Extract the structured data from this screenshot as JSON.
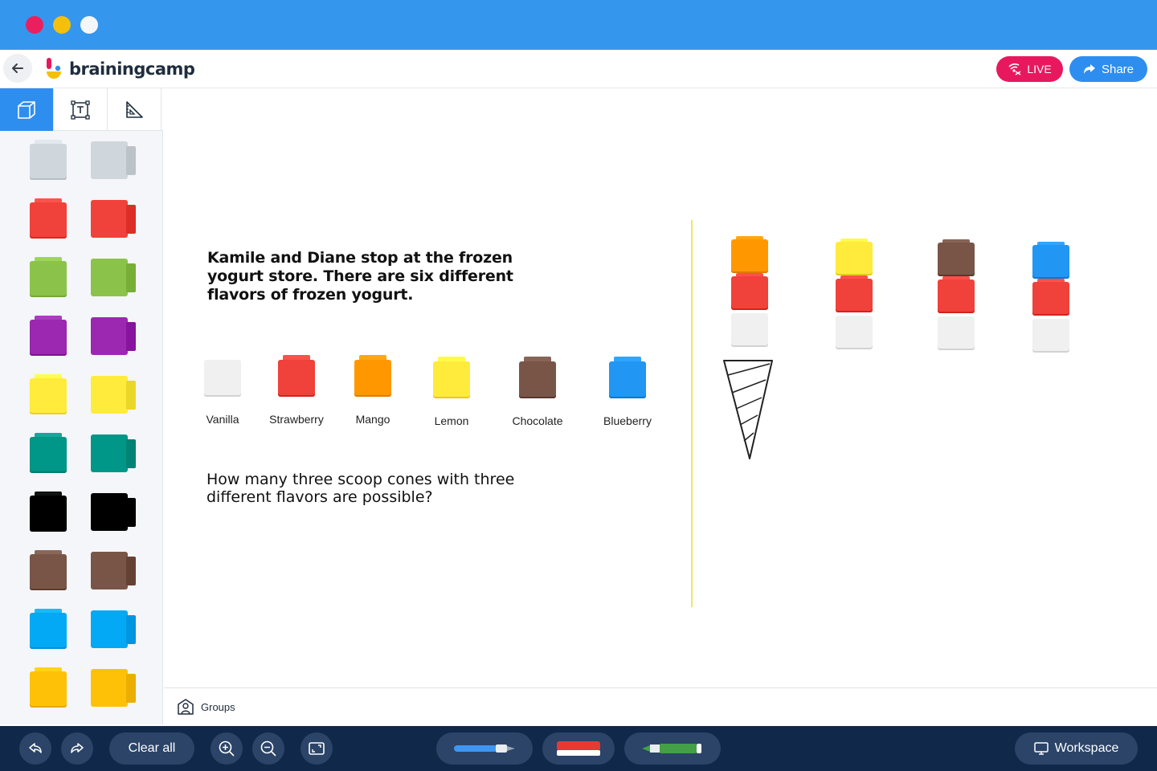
{
  "header": {
    "logo_text": "brainingcamp",
    "live_label": "LIVE",
    "share_label": "Share"
  },
  "sidebar": {
    "tabs": [
      {
        "name": "cubes",
        "icon": "cube-icon",
        "active": true
      },
      {
        "name": "text",
        "icon": "text-box-icon",
        "active": false
      },
      {
        "name": "measure",
        "icon": "ruler-triangle-icon",
        "active": false
      }
    ],
    "palette_colors": [
      "#cfd6dc",
      "#f0413a",
      "#8bc34a",
      "#9c27b0",
      "#ffeb3b",
      "#009688",
      "#000000",
      "#795548",
      "#03a9f4",
      "#ffc107"
    ]
  },
  "canvas": {
    "question": "Kamile and Diane stop at the frozen yogurt store. There are six different flavors of frozen yogurt.",
    "flavors": [
      {
        "label": "Vanilla",
        "color": "#f0f0f0"
      },
      {
        "label": "Strawberry",
        "color": "#f0413a"
      },
      {
        "label": "Mango",
        "color": "#ff9800"
      },
      {
        "label": "Lemon",
        "color": "#ffeb3b"
      },
      {
        "label": "Chocolate",
        "color": "#795548"
      },
      {
        "label": "Blueberry",
        "color": "#2196f3"
      }
    ],
    "prompt": "How many three scoop cones with three different flavors are possible?",
    "stacks": [
      [
        "#ff9800",
        "#f0413a",
        "#f0f0f0"
      ],
      [
        "#ffeb3b",
        "#f0413a",
        "#f0f0f0"
      ],
      [
        "#795548",
        "#f0413a",
        "#f0f0f0"
      ],
      [
        "#2196f3",
        "#f0413a",
        "#f0f0f0"
      ]
    ]
  },
  "groups": {
    "label": "Groups"
  },
  "toolbar": {
    "undo_icon": "undo-icon",
    "redo_icon": "redo-icon",
    "clear_label": "Clear all",
    "zoom_in_icon": "zoom-in-icon",
    "zoom_out_icon": "zoom-out-icon",
    "fit_icon": "fit-screen-icon",
    "tools": [
      "pen-tool",
      "eraser-tool",
      "highlighter-tool"
    ],
    "workspace_label": "Workspace"
  }
}
